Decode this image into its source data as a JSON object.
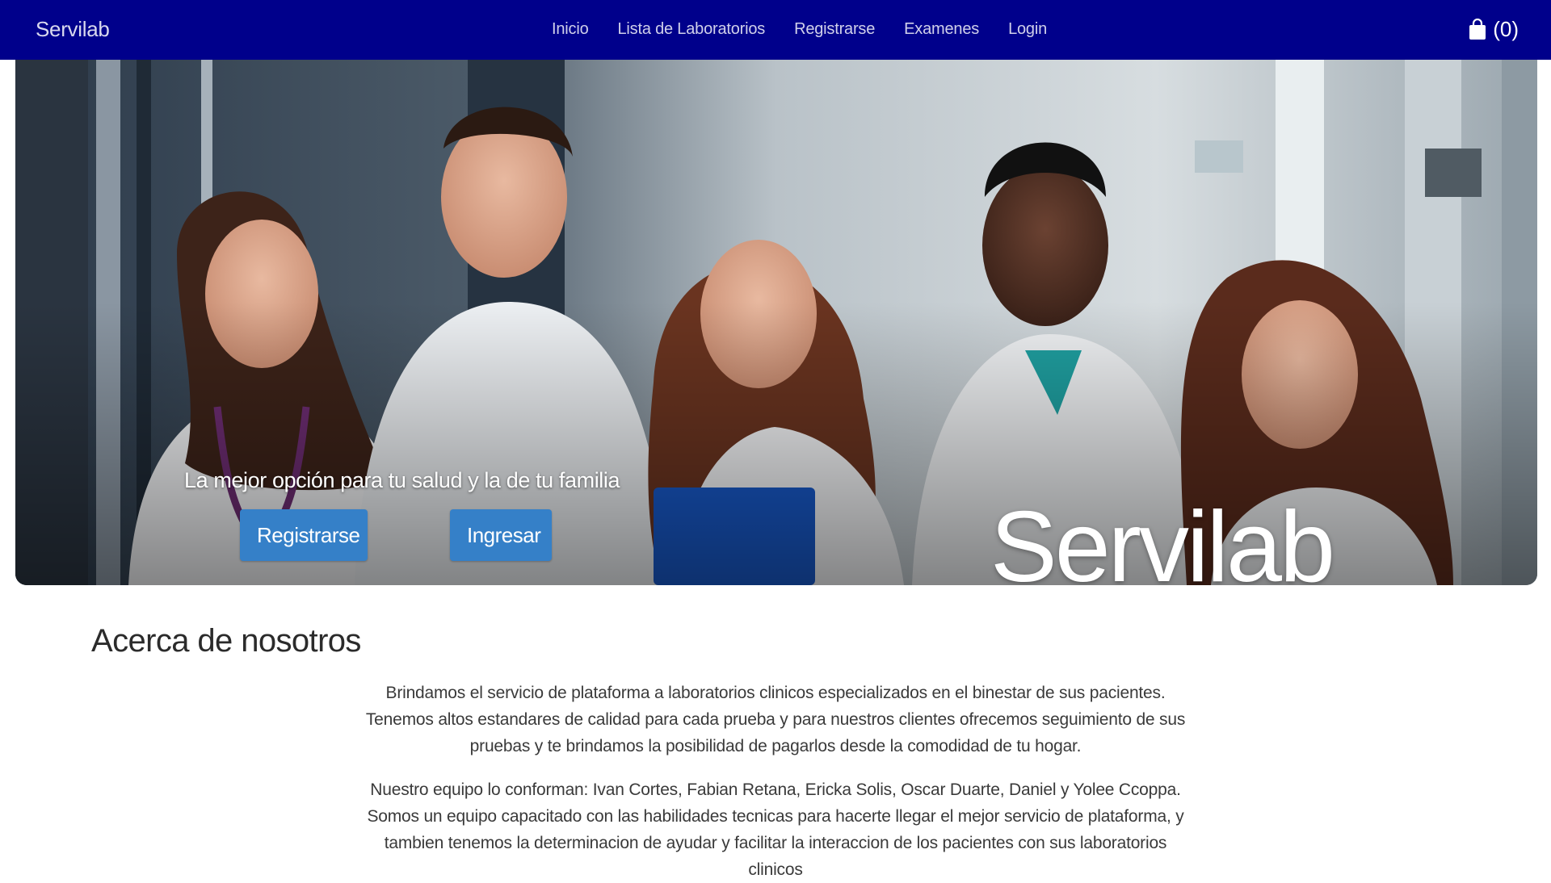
{
  "navbar": {
    "brand": "Servilab",
    "links": [
      "Inicio",
      "Lista de Laboratorios",
      "Registrarse",
      "Examenes",
      "Login"
    ],
    "cart_icon": "shopping-bag-icon",
    "cart_count": "(0)",
    "background_color": "#00008b"
  },
  "hero": {
    "image": "photo of five smiling medical staff in white coats in a hospital corridor",
    "tagline": "La mejor opción para tu salud y la de tu familia",
    "register_button": "Registrarse",
    "login_button": "Ingresar",
    "title": "Servilab",
    "button_color": "#3580c8"
  },
  "about": {
    "heading": "Acerca de nosotros",
    "paragraph_1": "Brindamos el servicio de plataforma a laboratorios clinicos especializados en el binestar de sus pacientes. Tenemos altos estandares de calidad para cada prueba y para nuestros clientes ofrecemos seguimiento de sus pruebas y te brindamos la posibilidad de pagarlos desde la comodidad de tu hogar.",
    "paragraph_2": "Nuestro equipo lo conforman: Ivan Cortes, Fabian Retana, Ericka Solis, Oscar Duarte, Daniel y Yolee Ccoppa. Somos un equipo capacitado con las habilidades tecnicas para hacerte llegar el mejor servicio de plataforma, y tambien tenemos la determinacion de ayudar y facilitar la interaccion de los pacientes con sus laboratorios clinicos"
  }
}
